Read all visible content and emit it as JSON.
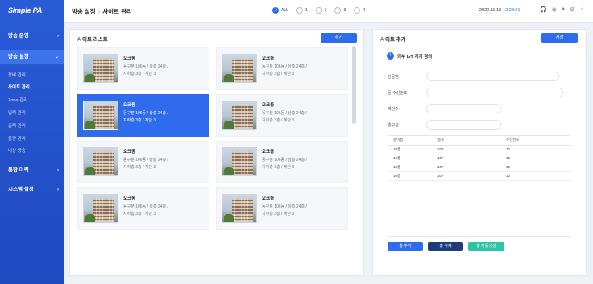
{
  "sidebar": {
    "logo": "Simple PA",
    "menus": [
      {
        "label": "방송 운영"
      },
      {
        "label": "방송 설정"
      },
      {
        "label": "통합 이력"
      },
      {
        "label": "시스템 설정"
      }
    ],
    "submenu": [
      {
        "label": "장비 관리"
      },
      {
        "label": "사이트 관리"
      },
      {
        "label": "Zone 관리"
      },
      {
        "label": "입력 관리"
      },
      {
        "label": "출력 관리"
      },
      {
        "label": "음량 관리"
      },
      {
        "label": "비상 방송"
      }
    ]
  },
  "header": {
    "crumb1": "방송 설정",
    "crumb2": "사이트 관리",
    "radios": [
      "ALL",
      "1",
      "2",
      "3",
      "4"
    ],
    "date": "2022.11.18",
    "time": "12:28:01"
  },
  "site_list": {
    "title": "사이트 리스트",
    "add_label": "추가",
    "cards": [
      {
        "name": "오크동",
        "line1": "동구분 106동  /  상층 24층  /",
        "line2": "지하층  3층  /  계단 3"
      },
      {
        "name": "오크동",
        "line1": "동구분 106동  /  상층 24층  /",
        "line2": "지하층  3층  /  계단 3"
      },
      {
        "name": "오크동",
        "line1": "동구분 106동  /  상층 24층  /",
        "line2": "지하층  3층  /  계단 3"
      },
      {
        "name": "오크동",
        "line1": "동구분 106동  /  상층 24층  /",
        "line2": "지하층  3층  /  계단 3"
      },
      {
        "name": "오크동",
        "line1": "동구분 106동  /  상층 24층  /",
        "line2": "지하층  3층  /  계단 3"
      },
      {
        "name": "오크동",
        "line1": "동구분 106동  /  상층 24층  /",
        "line2": "지하층  3층  /  계단 3"
      },
      {
        "name": "오크동",
        "line1": "동구분 106동  /  상층 24층  /",
        "line2": "지하층  3층  /  계단 3"
      },
      {
        "name": "오크동",
        "line1": "동구분 106동  /  상층 24층  /",
        "line2": "지하층  3층  /  계단 3"
      }
    ]
  },
  "site_add": {
    "title": "사이트 추가",
    "save_label": "저장",
    "section_num": "1",
    "section_title": "외부 IoT 기기 정의",
    "fields": {
      "building_label": "건물명",
      "building_value": "-",
      "receiver_label": "동 수신번호",
      "stairs_label": "계단수",
      "floors_label": "층구성"
    },
    "table": {
      "headers": [
        "층이름",
        "층수",
        "수신번호"
      ],
      "rows": [
        [
          "10층",
          "10F",
          "10"
        ],
        [
          "10층",
          "10F",
          "10"
        ],
        [
          "10층",
          "10F",
          "10"
        ],
        [
          "10층",
          "10F",
          "10"
        ]
      ]
    },
    "buttons": {
      "add_floor": "층 추가",
      "delete_floor": "층 삭제",
      "auto_generate": "층 자동생성"
    }
  }
}
